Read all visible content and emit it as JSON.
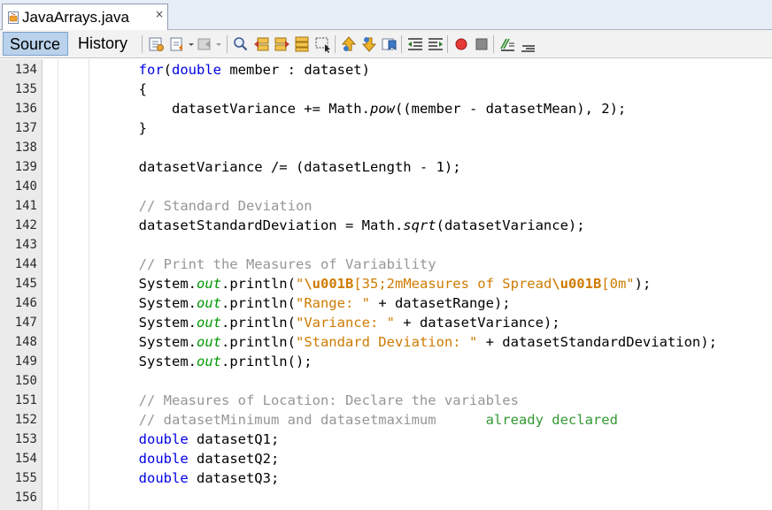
{
  "tab": {
    "filename": "JavaArrays.java",
    "close_glyph": "×",
    "icon": "java-file-icon"
  },
  "toolbar": {
    "source_label": "Source",
    "history_label": "History",
    "icons": [
      "last-edit-icon",
      "back-icon",
      "forward-icon",
      "find-selection-icon",
      "find-previous-icon",
      "find-next-icon",
      "toggle-highlight-icon",
      "toggle-rect-select-icon",
      "previous-bookmark-icon",
      "next-bookmark-icon",
      "toggle-bookmark-icon",
      "shift-left-icon",
      "shift-right-icon",
      "start-macro-icon",
      "stop-macro-icon",
      "comment-icon",
      "uncomment-icon"
    ]
  },
  "colors": {
    "keyword": "#0000e6",
    "comment": "#969696",
    "string": "#ce7b00",
    "static_field": "#009900",
    "source_tab_bg": "#b9d1ea",
    "gutter_bg": "#ebebeb"
  },
  "lines": [
    {
      "n": "134",
      "parts": [
        {
          "t": "        "
        },
        {
          "t": "for",
          "c": "kw"
        },
        {
          "t": "("
        },
        {
          "t": "double",
          "c": "kw"
        },
        {
          "t": " member : dataset)"
        }
      ]
    },
    {
      "n": "135",
      "parts": [
        {
          "t": "        {"
        }
      ]
    },
    {
      "n": "136",
      "parts": [
        {
          "t": "            datasetVariance += Math."
        },
        {
          "t": "pow",
          "c": "it"
        },
        {
          "t": "((member - datasetMean), 2);"
        }
      ]
    },
    {
      "n": "137",
      "parts": [
        {
          "t": "        }"
        }
      ]
    },
    {
      "n": "138",
      "parts": []
    },
    {
      "n": "139",
      "parts": [
        {
          "t": "        datasetVariance /= (datasetLength - 1);"
        }
      ]
    },
    {
      "n": "140",
      "parts": []
    },
    {
      "n": "141",
      "parts": [
        {
          "t": "        "
        },
        {
          "t": "// Standard Deviation",
          "c": "cm"
        }
      ]
    },
    {
      "n": "142",
      "parts": [
        {
          "t": "        datasetStandardDeviation = Math."
        },
        {
          "t": "sqrt",
          "c": "it"
        },
        {
          "t": "(datasetVariance);"
        }
      ]
    },
    {
      "n": "143",
      "parts": []
    },
    {
      "n": "144",
      "parts": [
        {
          "t": "        "
        },
        {
          "t": "// Print the Measures of Variability",
          "c": "cm"
        }
      ]
    },
    {
      "n": "145",
      "parts": [
        {
          "t": "        System."
        },
        {
          "t": "out",
          "c": "fld"
        },
        {
          "t": ".println("
        },
        {
          "t": "\"",
          "c": "str"
        },
        {
          "t": "\\u001B",
          "c": "esc"
        },
        {
          "t": "[35;2mMeasures of Spread",
          "c": "str"
        },
        {
          "t": "\\u001B",
          "c": "esc"
        },
        {
          "t": "[0m\"",
          "c": "str"
        },
        {
          "t": ");"
        }
      ]
    },
    {
      "n": "146",
      "parts": [
        {
          "t": "        System."
        },
        {
          "t": "out",
          "c": "fld"
        },
        {
          "t": ".println("
        },
        {
          "t": "\"Range: \"",
          "c": "str"
        },
        {
          "t": " + datasetRange);"
        }
      ]
    },
    {
      "n": "147",
      "parts": [
        {
          "t": "        System."
        },
        {
          "t": "out",
          "c": "fld"
        },
        {
          "t": ".println("
        },
        {
          "t": "\"Variance: \"",
          "c": "str"
        },
        {
          "t": " + datasetVariance);"
        }
      ]
    },
    {
      "n": "148",
      "parts": [
        {
          "t": "        System."
        },
        {
          "t": "out",
          "c": "fld"
        },
        {
          "t": ".println("
        },
        {
          "t": "\"Standard Deviation: \"",
          "c": "str"
        },
        {
          "t": " + datasetStandardDeviation);"
        }
      ]
    },
    {
      "n": "149",
      "parts": [
        {
          "t": "        System."
        },
        {
          "t": "out",
          "c": "fld"
        },
        {
          "t": ".println();"
        }
      ]
    },
    {
      "n": "150",
      "parts": []
    },
    {
      "n": "151",
      "parts": [
        {
          "t": "        "
        },
        {
          "t": "// Measures of Location: Declare the variables",
          "c": "cm"
        }
      ]
    },
    {
      "n": "152",
      "parts": [
        {
          "t": "        "
        },
        {
          "t": "// datasetMinimum and datasetmaximum      ",
          "c": "cm"
        },
        {
          "t": "already declared",
          "c": "green"
        }
      ]
    },
    {
      "n": "153",
      "parts": [
        {
          "t": "        "
        },
        {
          "t": "double",
          "c": "kw"
        },
        {
          "t": " datasetQ1;"
        }
      ]
    },
    {
      "n": "154",
      "parts": [
        {
          "t": "        "
        },
        {
          "t": "double",
          "c": "kw"
        },
        {
          "t": " datasetQ2;"
        }
      ]
    },
    {
      "n": "155",
      "parts": [
        {
          "t": "        "
        },
        {
          "t": "double",
          "c": "kw"
        },
        {
          "t": " datasetQ3;"
        }
      ]
    },
    {
      "n": "156",
      "parts": []
    }
  ]
}
